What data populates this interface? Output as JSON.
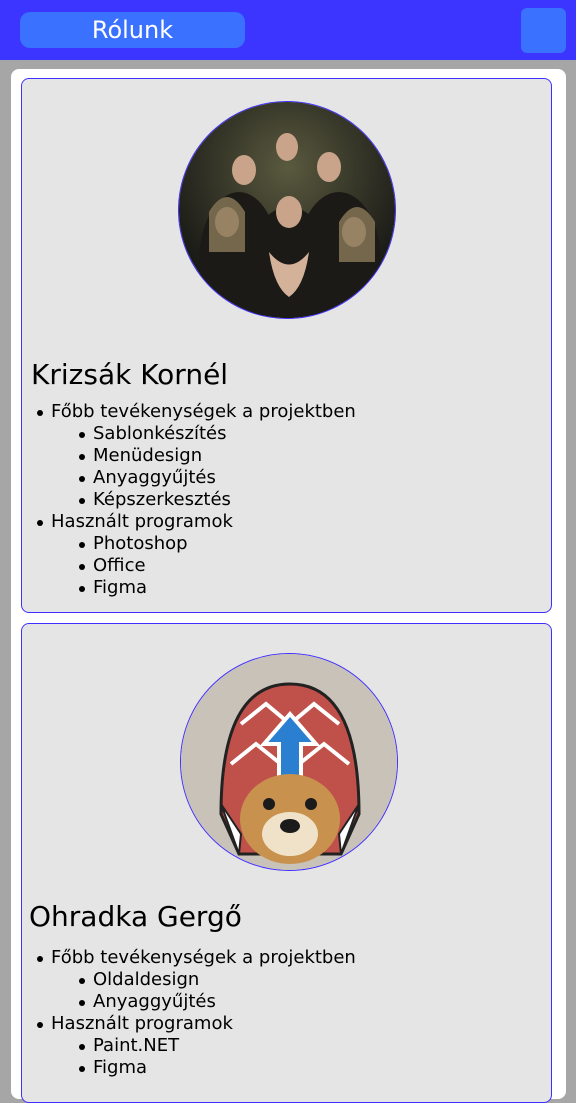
{
  "header": {
    "title": "Rólunk",
    "menu_button_label": ""
  },
  "members": [
    {
      "name": "Krizsák Kornél",
      "sections": [
        {
          "label": "Főbb tevékenységek a projektben",
          "items": [
            "Sablonkészítés",
            "Menüdesign",
            "Anyaggyűjtés",
            "Képszerkesztés"
          ]
        },
        {
          "label": "Használt programok",
          "items": [
            "Photoshop",
            "Office",
            "Figma"
          ]
        }
      ]
    },
    {
      "name": "Ohradka Gergő",
      "sections": [
        {
          "label": "Főbb tevékenységek a projektben",
          "items": [
            "Oldaldesign",
            "Anyaggyűjtés"
          ]
        },
        {
          "label": "Használt programok",
          "items": [
            "Paint.NET",
            "Figma"
          ]
        }
      ]
    }
  ],
  "colors": {
    "header": "#3c35ff",
    "pill": "#3a71ff",
    "card_border": "#4030ff",
    "card_bg": "#e5e5e5"
  }
}
